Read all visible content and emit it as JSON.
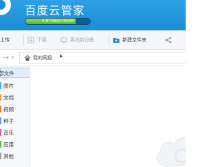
{
  "header": {
    "app_title": "百度云管家",
    "quota": {
      "used": 3.87,
      "total": 5.0,
      "text": "3.87GB/5.00GB"
    }
  },
  "toolbar": {
    "upload": "上传",
    "download": "下载",
    "offline": "离线新设备",
    "new_folder": "新建文件夹"
  },
  "address": {
    "crumb": "我的网盘"
  },
  "sidebar": {
    "all_files": "部文件",
    "items": [
      {
        "label": "图片",
        "color": "#3cb4e8"
      },
      {
        "label": "文档",
        "color": "#f0a33a"
      },
      {
        "label": "视频",
        "color": "#f07c3a"
      },
      {
        "label": "种子",
        "color": "#6f9bd8"
      },
      {
        "label": "音乐",
        "color": "#e85d8c"
      },
      {
        "label": "应用",
        "color": "#64bd3c"
      },
      {
        "label": "其他",
        "color": "#9e9e9e"
      }
    ]
  },
  "colors": {
    "accent": "#1b8cd6",
    "quota_fill": "#56b826"
  },
  "icons": {
    "upload": "upload-icon",
    "download": "download-icon",
    "offline": "device-icon",
    "new_folder": "new-folder-icon",
    "more": "more-icon",
    "home": "home-icon",
    "forward": "forward-arrow-icon"
  }
}
